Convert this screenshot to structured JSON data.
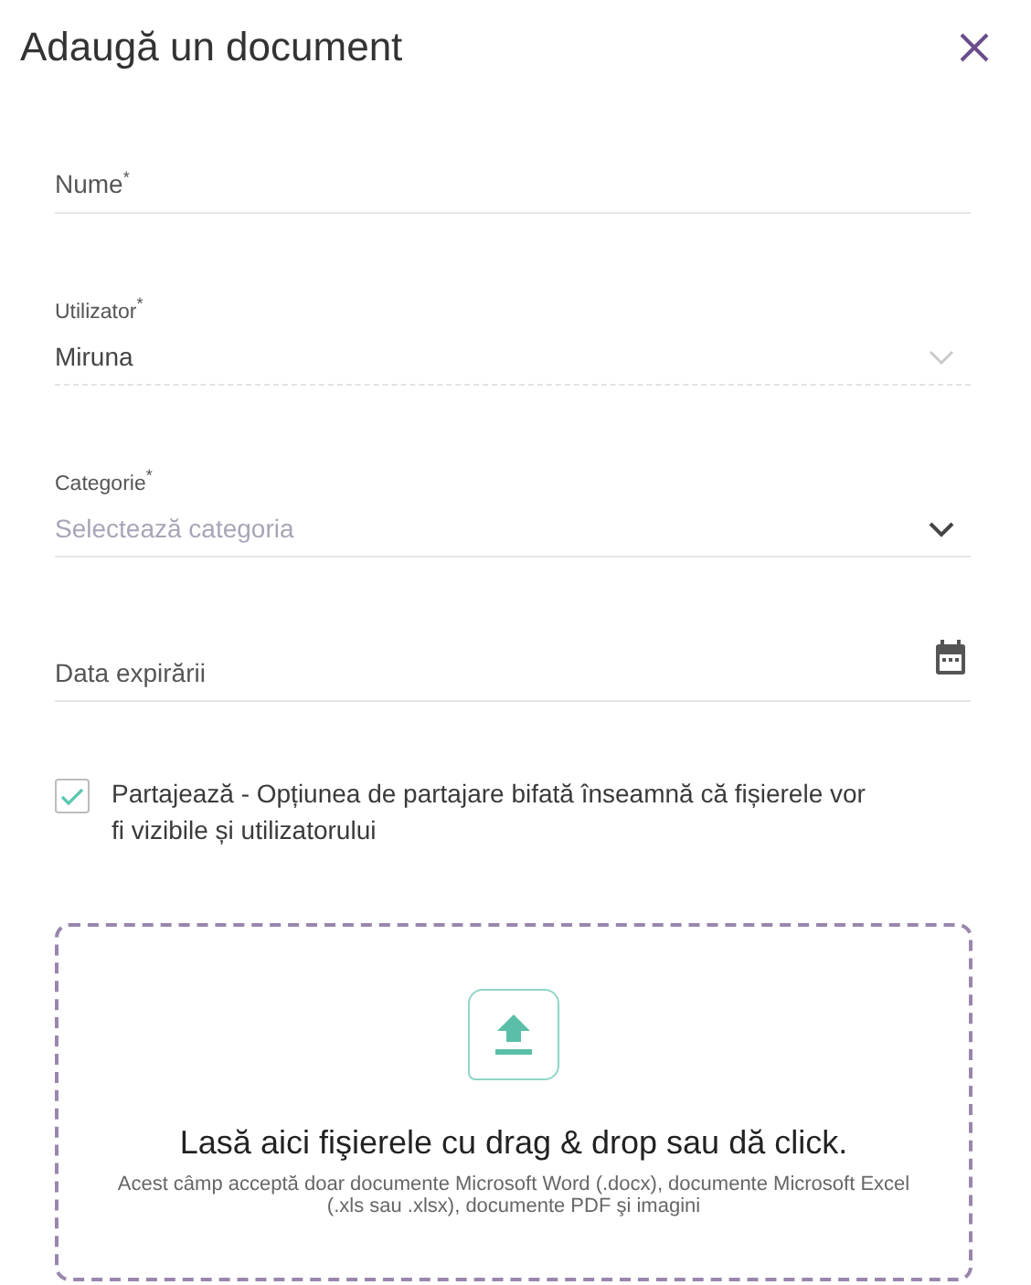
{
  "dialog": {
    "title": "Adaugă un document"
  },
  "fields": [
    {
      "kind": "text",
      "label": "Nume$^{*}$"
    },
    {
      "kind": "select",
      "label": "Utilizator$^{*}$",
      "value": "Miruna",
      "disabled": true
    },
    {
      "kind": "select",
      "label": "Categorie$^{*}$",
      "placeholder": "Selectează categoria",
      "disabled": false
    },
    {
      "kind": "date",
      "label": "Data expirării"
    }
  ],
  "share": {
    "checked": true,
    "label": "Partajează - Opțiunea de partajare bifată înseamnă că fișierele vor fi vizibile și utilizatorului"
  },
  "dropzone": {
    "heading": "Lasă aici fişierele cu drag & drop sau dă click.",
    "hint": "Acest câmp acceptă doar documente Microsoft Word (.docx), documente Microsoft Excel (.xls sau .xlsx), documente PDF şi imagini"
  }
}
